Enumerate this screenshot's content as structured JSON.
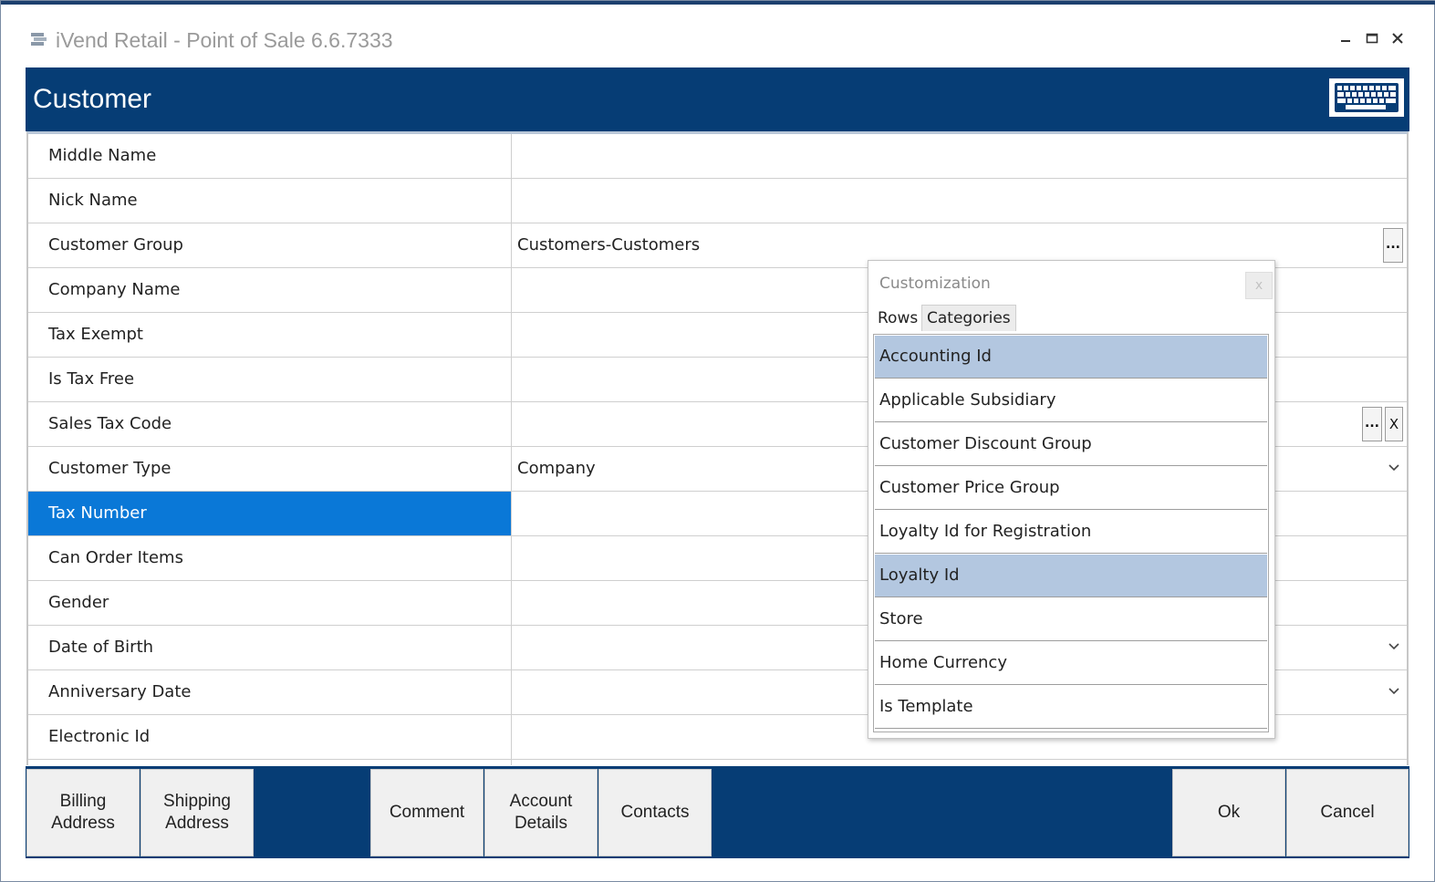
{
  "window": {
    "title": "iVend Retail - Point of Sale 6.6.7333",
    "minimize_icon": "minimize-icon",
    "maximize_icon": "maximize-icon",
    "close_icon": "close-icon",
    "app_icon": "ivend-app-icon"
  },
  "header": {
    "title": "Customer",
    "keyboard_icon": "keyboard-icon",
    "bg_color": "#063d75"
  },
  "grid": {
    "rows": [
      {
        "label": "Middle Name",
        "value": ""
      },
      {
        "label": "Nick Name",
        "value": ""
      },
      {
        "label": "Customer Group",
        "value": "Customers-Customers",
        "editor": "ellipsis"
      },
      {
        "label": "Company Name",
        "value": ""
      },
      {
        "label": "Tax Exempt",
        "value": ""
      },
      {
        "label": "Is Tax Free",
        "value": ""
      },
      {
        "label": "Sales Tax Code",
        "value": "",
        "editor": "ellipsis-clear",
        "clear_label": "X"
      },
      {
        "label": "Customer Type",
        "value": "Company",
        "editor": "dropdown"
      },
      {
        "label": "Tax Number",
        "value": "",
        "selected": true
      },
      {
        "label": "Can Order Items",
        "value": ""
      },
      {
        "label": "Gender",
        "value": ""
      },
      {
        "label": "Date of Birth",
        "value": "",
        "editor": "dropdown"
      },
      {
        "label": "Anniversary Date",
        "value": "",
        "editor": "dropdown"
      },
      {
        "label": "Electronic Id",
        "value": ""
      }
    ],
    "ellipsis_label": "...",
    "selected_color": "#0a78d7"
  },
  "customization": {
    "title": "Customization",
    "close_label": "x",
    "tabs": [
      {
        "label": "Rows",
        "active": true
      },
      {
        "label": "Categories",
        "active": false
      }
    ],
    "items": [
      {
        "label": "Accounting Id",
        "highlighted": true
      },
      {
        "label": "Applicable Subsidiary",
        "highlighted": false
      },
      {
        "label": "Customer Discount Group",
        "highlighted": false
      },
      {
        "label": "Customer Price Group",
        "highlighted": false
      },
      {
        "label": "Loyalty Id for Registration",
        "highlighted": false
      },
      {
        "label": "Loyalty Id",
        "highlighted": true
      },
      {
        "label": "Store",
        "highlighted": false
      },
      {
        "label": "Home Currency",
        "highlighted": false
      },
      {
        "label": "Is Template",
        "highlighted": false
      }
    ],
    "highlight_color": "#b3c7e0"
  },
  "footer": {
    "buttons": [
      {
        "label": "Billing\nAddress"
      },
      {
        "label": "Shipping\nAddress"
      },
      {
        "label": "Comment"
      },
      {
        "label": "Account\nDetails"
      },
      {
        "label": "Contacts"
      },
      {
        "label": "Ok"
      },
      {
        "label": "Cancel"
      }
    ]
  }
}
